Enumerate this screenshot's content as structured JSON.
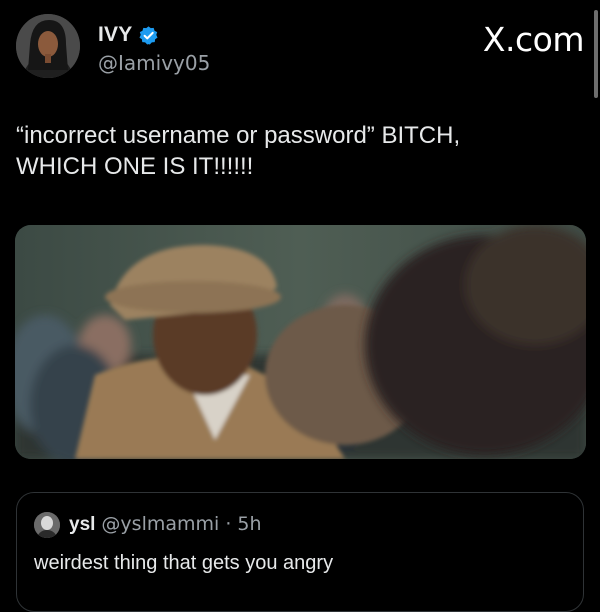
{
  "author": {
    "display_name": "IVY",
    "handle": "@Iamivy05",
    "verified_icon": "verified-badge-icon"
  },
  "brand": {
    "label": "X.com"
  },
  "tweet": {
    "line1": "“incorrect username or password” BITCH,",
    "line2": "WHICH ONE IS IT!!!!!!"
  },
  "media": {
    "icon": "video-still-image"
  },
  "quoted_tweet": {
    "display_name": "ysl",
    "handle_time": "@yslmammi · 5h",
    "text": "weirdest thing that gets you angry"
  },
  "colors": {
    "background": "#000000",
    "text": "#e7e9ea",
    "secondary": "#9aa0a6",
    "verified": "#1d9bf0",
    "border": "#2f3336"
  }
}
